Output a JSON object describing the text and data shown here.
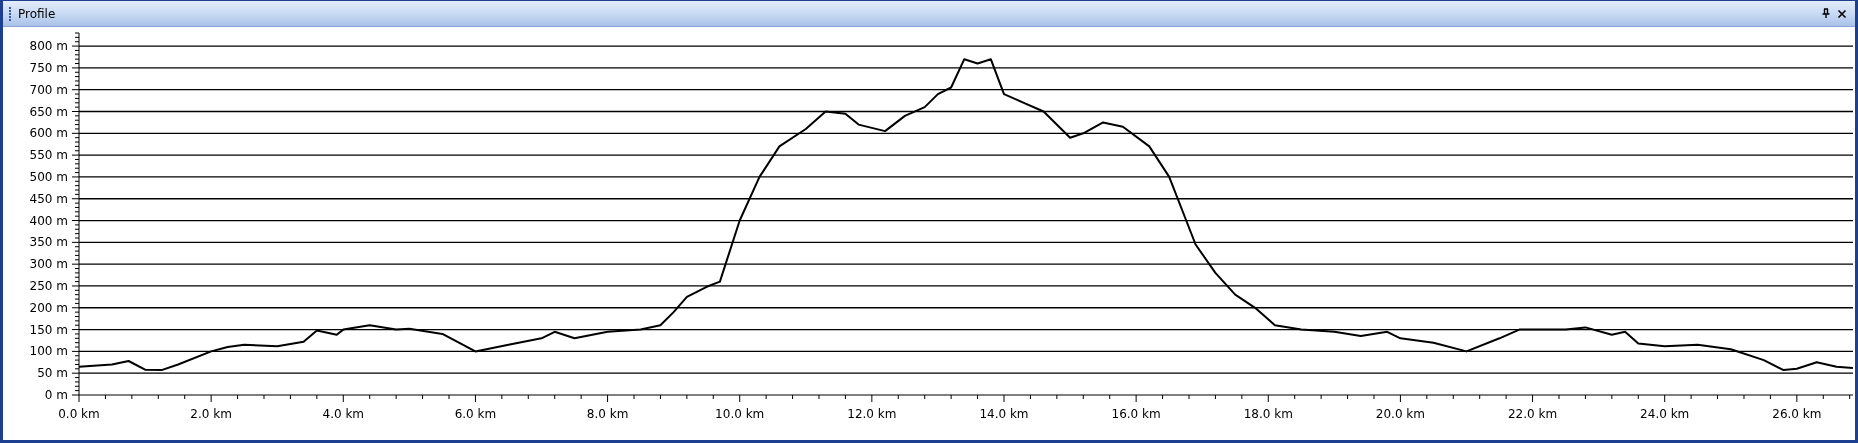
{
  "window": {
    "title": "Profile"
  },
  "chart_data": {
    "type": "line",
    "xlim": [
      0,
      26.85
    ],
    "ylim": [
      0,
      830
    ],
    "grid": true,
    "xticks": [
      {
        "value": 0,
        "label": "0.0 km"
      },
      {
        "value": 2,
        "label": "2.0 km"
      },
      {
        "value": 4,
        "label": "4.0 km"
      },
      {
        "value": 6,
        "label": "6.0 km"
      },
      {
        "value": 8,
        "label": "8.0 km"
      },
      {
        "value": 10,
        "label": "10.0 km"
      },
      {
        "value": 12,
        "label": "12.0 km"
      },
      {
        "value": 14,
        "label": "14.0 km"
      },
      {
        "value": 16,
        "label": "16.0 km"
      },
      {
        "value": 18,
        "label": "18.0 km"
      },
      {
        "value": 20,
        "label": "20.0 km"
      },
      {
        "value": 22,
        "label": "22.0 km"
      },
      {
        "value": 24,
        "label": "24.0 km"
      },
      {
        "value": 26,
        "label": "26.0 km"
      }
    ],
    "yticks": [
      {
        "value": 0,
        "label": "0 m"
      },
      {
        "value": 50,
        "label": "50 m"
      },
      {
        "value": 100,
        "label": "100 m"
      },
      {
        "value": 150,
        "label": "150 m"
      },
      {
        "value": 200,
        "label": "200 m"
      },
      {
        "value": 250,
        "label": "250 m"
      },
      {
        "value": 300,
        "label": "300 m"
      },
      {
        "value": 350,
        "label": "350 m"
      },
      {
        "value": 400,
        "label": "400 m"
      },
      {
        "value": 450,
        "label": "450 m"
      },
      {
        "value": 500,
        "label": "500 m"
      },
      {
        "value": 550,
        "label": "550 m"
      },
      {
        "value": 600,
        "label": "600 m"
      },
      {
        "value": 650,
        "label": "650 m"
      },
      {
        "value": 700,
        "label": "700 m"
      },
      {
        "value": 750,
        "label": "750 m"
      },
      {
        "value": 800,
        "label": "800 m"
      }
    ],
    "x": [
      0,
      0.5,
      0.75,
      1.0,
      1.25,
      1.5,
      2.0,
      2.25,
      2.5,
      3.0,
      3.4,
      3.6,
      3.9,
      4.0,
      4.4,
      4.8,
      5.0,
      5.5,
      6.0,
      6.5,
      7.0,
      7.2,
      7.5,
      8.0,
      8.5,
      8.8,
      9.0,
      9.2,
      9.5,
      9.7,
      10.0,
      10.3,
      10.6,
      11.0,
      11.3,
      11.6,
      11.8,
      12.2,
      12.5,
      12.8,
      13.0,
      13.2,
      13.4,
      13.6,
      13.8,
      14.0,
      14.3,
      14.6,
      15.0,
      15.2,
      15.5,
      15.8,
      16.2,
      16.5,
      16.9,
      17.2,
      17.5,
      17.8,
      18.1,
      18.5,
      19.0,
      19.4,
      19.8,
      20.0,
      20.5,
      21.0,
      21.5,
      21.8,
      22.5,
      22.8,
      23.2,
      23.4,
      23.6,
      24.0,
      24.5,
      25.0,
      25.5,
      25.8,
      26.0,
      26.3,
      26.6,
      26.85
    ],
    "series": [
      {
        "color": "#000000",
        "values": [
          65,
          70,
          78,
          58,
          57,
          70,
          100,
          110,
          115,
          112,
          122,
          148,
          138,
          150,
          160,
          150,
          152,
          140,
          100,
          115,
          130,
          145,
          130,
          145,
          150,
          160,
          190,
          225,
          248,
          260,
          400,
          500,
          570,
          610,
          650,
          645,
          620,
          605,
          640,
          660,
          690,
          705,
          770,
          760,
          770,
          690,
          670,
          650,
          590,
          600,
          625,
          615,
          570,
          500,
          345,
          280,
          230,
          200,
          160,
          150,
          145,
          135,
          145,
          130,
          120,
          100,
          130,
          150,
          150,
          155,
          138,
          145,
          118,
          112,
          115,
          105,
          80,
          57,
          60,
          75,
          65,
          62
        ]
      }
    ]
  }
}
